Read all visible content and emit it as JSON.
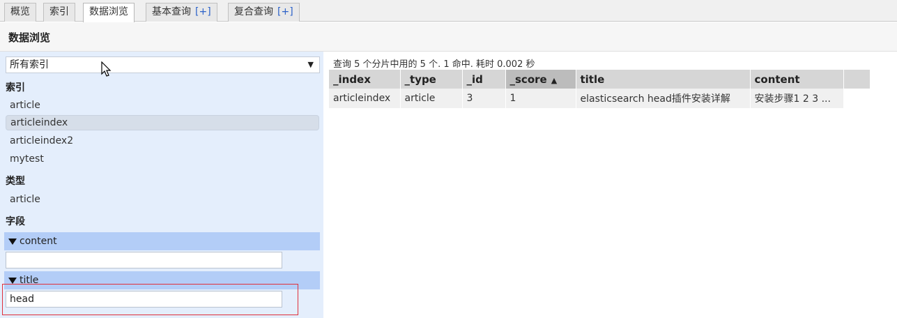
{
  "tabs": [
    {
      "label": "概览",
      "plus": ""
    },
    {
      "label": "索引",
      "plus": ""
    },
    {
      "label": "数据浏览",
      "plus": ""
    },
    {
      "label": "基本查询",
      "plus": "[+]"
    },
    {
      "label": "复合查询",
      "plus": "[+]"
    }
  ],
  "active_tab": "数据浏览",
  "header": {
    "title": "数据浏览"
  },
  "sidebar": {
    "index_select": {
      "selected": "所有索引",
      "caret": "▼"
    },
    "sections": {
      "indices": "索引",
      "types": "类型",
      "fields": "字段"
    },
    "indices": [
      "article",
      "articleindex",
      "articleindex2",
      "mytest"
    ],
    "selected_index": "articleindex",
    "types": [
      "article"
    ],
    "fields": [
      {
        "name": "content",
        "value": ""
      },
      {
        "name": "title",
        "value": "head"
      }
    ]
  },
  "results": {
    "summary": "查询 5 个分片中用的 5 个. 1 命中. 耗时 0.002 秒",
    "columns": [
      "_index",
      "_type",
      "_id",
      "_score",
      "title",
      "content"
    ],
    "sort_column": "_score",
    "sort_arrow": "▲",
    "rows": [
      [
        "articleindex",
        "article",
        "3",
        "1",
        "elasticsearch head插件安装详解",
        "安装步骤1 2 3 ..."
      ]
    ]
  }
}
